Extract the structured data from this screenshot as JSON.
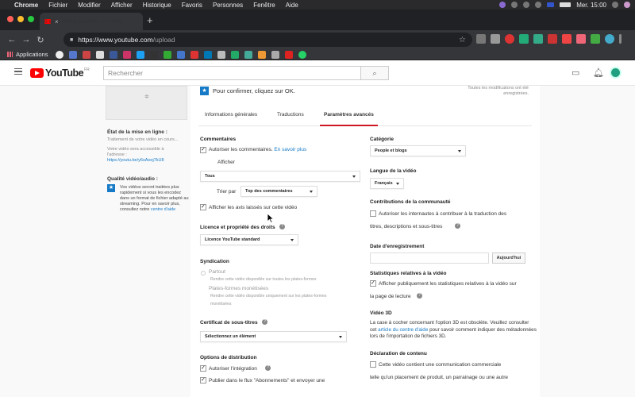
{
  "menubar": {
    "apple": "",
    "items": [
      "Chrome",
      "Fichier",
      "Modifier",
      "Afficher",
      "Historique",
      "Favoris",
      "Personnes",
      "Fenêtre",
      "Aide"
    ],
    "clock": "Mer. 15:00"
  },
  "tab": {
    "title": "0 sur 1 vidéos ajoutées - YouTube",
    "close": "×",
    "new": "+"
  },
  "omnibox": {
    "host": "https://www.youtube.com",
    "path": "/upload"
  },
  "bookmarks": {
    "apps_label": "Applications"
  },
  "youtube": {
    "logo_text": "YouTube",
    "region": "FR",
    "search_placeholder": "Rechercher"
  },
  "left": {
    "status_title": "État de la mise en ligne :",
    "status_text": "Traitement de votre vidéo en cours...",
    "url_text": "Votre vidéo sera accessible à l'adresse :",
    "url_link": "https://youtu.be/y6sAooj7kU8",
    "quality_title": "Qualité vidéo/audio :",
    "quality_text": "Vos vidéos seront traitées plus rapidement si vous les encodez dans un format de fichier adapté au streaming. Pour en savoir plus, consultez notre",
    "quality_link": "centre d'aide"
  },
  "card": {
    "confirm": "Pour confirmer, cliquez sur OK.",
    "saved_note": "Toutes les modifications ont été enregistrées.",
    "tabs": [
      "Informations générales",
      "Traductions",
      "Paramètres avancés"
    ]
  },
  "comments": {
    "title": "Commentaires",
    "allow": "Autoriser les commentaires.",
    "learn_more": "En savoir plus",
    "show_label": "Afficher",
    "show_value": "Tous",
    "sort_label": "Trier par",
    "sort_value": "Top des commentaires",
    "ratings": "Afficher les avis laissés sur cette vidéo"
  },
  "license": {
    "title": "Licence et propriété des droits",
    "value": "Licence YouTube standard"
  },
  "syndication": {
    "title": "Syndication",
    "everywhere": "Partout",
    "everywhere_sub": "Rendre cette vidéo disponible sur toutes les plates-formes",
    "monetized": "Plates-formes monétisées",
    "monetized_sub1": "Rendre cette vidéo disponible uniquement sur les plates-formes",
    "monetized_sub2": "monétisées"
  },
  "subtitles": {
    "title": "Certificat de sous-titres",
    "value": "Sélectionnez un élément"
  },
  "distribution": {
    "title": "Options de distribution",
    "embed": "Autoriser l'intégration",
    "feed": "Publier dans le flux \"Abonnements\" et envoyer une"
  },
  "category": {
    "title": "Catégorie",
    "value": "People et blogs"
  },
  "language": {
    "title": "Langue de la vidéo",
    "value": "Français"
  },
  "community": {
    "title": "Contributions de la communauté",
    "line1": "Autoriser les internautes à contribuer à la traduction des",
    "line2": "titres, descriptions et sous-titres"
  },
  "recording": {
    "title": "Date d'enregistrement",
    "today": "Aujourd'hui"
  },
  "stats": {
    "title": "Statistiques relatives à la vidéo",
    "line1": "Afficher publiquement les statistiques relatives à la vidéo sur",
    "line2": "la page de lecture"
  },
  "video3d": {
    "title": "Vidéo 3D",
    "text_a": "La case à cocher concernant l'option 3D est obsolète. Veuillez consulter cet",
    "link": "article du centre d'aide",
    "text_b": "pour savoir comment indiquer des métadonnées lors de l'importation de fichiers 3D."
  },
  "declaration": {
    "title": "Déclaration de contenu",
    "line1": "Cette vidéo contient une communication commerciale",
    "line2": "telle qu'un placement de produit, un parrainage ou une autre"
  },
  "colors": {
    "accent": "#167ac6",
    "youtube_red": "#ff0000",
    "tab_underline": "#cc181e"
  }
}
